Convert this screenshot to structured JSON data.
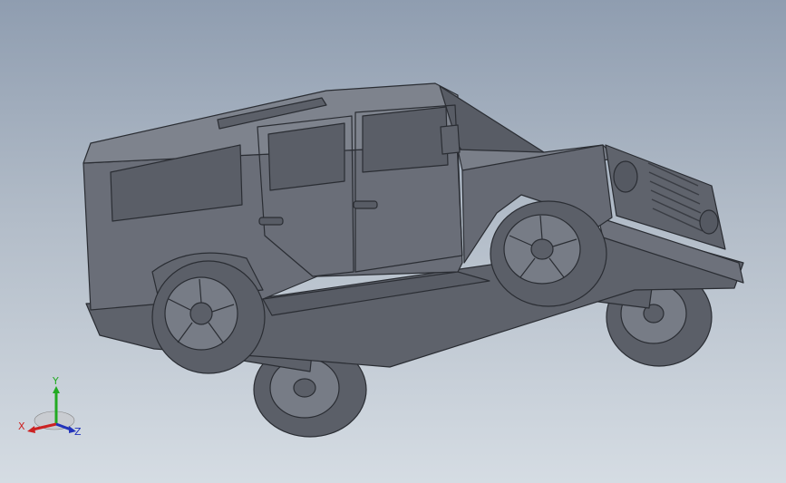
{
  "triad": {
    "x_label": "X",
    "y_label": "Y",
    "z_label": "Z",
    "x_color": "#cc2222",
    "y_color": "#22aa22",
    "z_color": "#2233bb"
  },
  "colors": {
    "body": "#6a6e78",
    "body_dark": "#4d515a",
    "body_light": "#7e838d",
    "tire": "#5b5f68",
    "rim": "#777c86",
    "edge": "#2a2d33"
  }
}
